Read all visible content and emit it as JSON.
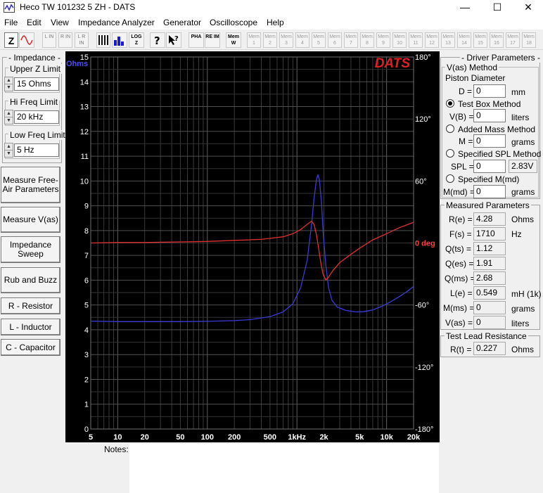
{
  "window": {
    "title": "Heco TW 101232 5 ZH - DATS",
    "minimize": "—",
    "maximize": "☐",
    "close": "✕"
  },
  "menu": [
    "File",
    "Edit",
    "View",
    "Impedance Analyzer",
    "Generator",
    "Oscilloscope",
    "Help"
  ],
  "toolbar": {
    "z_label": "Z",
    "lin": "L IN",
    "rin": "R IN",
    "lrin": "L R IN",
    "logz": "LOG Z",
    "pha": "PHA",
    "reim": "RE IM",
    "memw": "Mem W",
    "mem_label": "Mem",
    "mem_numbers": [
      "1",
      "2",
      "3",
      "4",
      "5",
      "6",
      "7",
      "8",
      "9",
      "10",
      "11",
      "12",
      "13",
      "14",
      "15",
      "16",
      "17",
      "18"
    ]
  },
  "left_panel": {
    "impedance_title": "- Impedance -",
    "upper_z": {
      "label": "Upper Z Limit",
      "value": "15 Ohms"
    },
    "hi_freq": {
      "label": "Hi Freq Limit",
      "value": "20 kHz"
    },
    "low_freq": {
      "label": "Low Freq Limit",
      "value": "5 Hz"
    },
    "buttons": [
      "Measure Free-Air Parameters",
      "Measure V(as)",
      "Impedance Sweep",
      "Rub and Buzz",
      "R - Resistor",
      "L - Inductor",
      "C - Capacitor"
    ]
  },
  "chart_data": {
    "type": "line",
    "title": "DATS",
    "x_scale": "log",
    "xlim": [
      5,
      20000
    ],
    "x_ticks": [
      {
        "value": 5,
        "label": "5"
      },
      {
        "value": 10,
        "label": "10"
      },
      {
        "value": 20,
        "label": "20"
      },
      {
        "value": 50,
        "label": "50"
      },
      {
        "value": 100,
        "label": "100"
      },
      {
        "value": 200,
        "label": "200"
      },
      {
        "value": 500,
        "label": "500"
      },
      {
        "value": 1000,
        "label": "1kHz"
      },
      {
        "value": 2000,
        "label": "2k"
      },
      {
        "value": 5000,
        "label": "5k"
      },
      {
        "value": 10000,
        "label": "10k"
      },
      {
        "value": 20000,
        "label": "20k"
      }
    ],
    "y_left": {
      "label": "Ohms",
      "min": 0,
      "max": 15,
      "ticks": [
        "0",
        "1",
        "2",
        "3",
        "4",
        "5",
        "6",
        "7",
        "8",
        "9",
        "10",
        "11",
        "12",
        "13",
        "14",
        "15"
      ]
    },
    "y_right": {
      "label": "deg",
      "min": -180,
      "max": 180,
      "ticks": [
        {
          "value": 180,
          "label": "180°"
        },
        {
          "value": 120,
          "label": "120°"
        },
        {
          "value": 60,
          "label": "60°"
        },
        {
          "value": 0,
          "label": "0 deg"
        },
        {
          "value": -60,
          "label": "-60°"
        },
        {
          "value": -120,
          "label": "-120°"
        },
        {
          "value": -180,
          "label": "-180°"
        }
      ]
    },
    "grid": true,
    "series": [
      {
        "axis": "left",
        "color": "#3a3ad8",
        "points": [
          [
            5,
            4.35
          ],
          [
            10,
            4.33
          ],
          [
            50,
            4.33
          ],
          [
            100,
            4.34
          ],
          [
            200,
            4.37
          ],
          [
            300,
            4.41
          ],
          [
            500,
            4.53
          ],
          [
            700,
            4.72
          ],
          [
            900,
            5.05
          ],
          [
            1100,
            5.7
          ],
          [
            1300,
            6.8
          ],
          [
            1450,
            8.2
          ],
          [
            1550,
            9.3
          ],
          [
            1650,
            10.05
          ],
          [
            1710,
            10.25
          ],
          [
            1780,
            10.05
          ],
          [
            1870,
            9.2
          ],
          [
            1970,
            7.8
          ],
          [
            2100,
            6.6
          ],
          [
            2250,
            5.7
          ],
          [
            2450,
            5.2
          ],
          [
            2800,
            4.92
          ],
          [
            3500,
            4.78
          ],
          [
            4500,
            4.72
          ],
          [
            5500,
            4.73
          ],
          [
            7000,
            4.8
          ],
          [
            9000,
            4.96
          ],
          [
            11000,
            5.12
          ],
          [
            14000,
            5.35
          ],
          [
            17000,
            5.55
          ],
          [
            20000,
            5.75
          ]
        ]
      },
      {
        "axis": "right",
        "color": "#e03030",
        "points": [
          [
            5,
            0
          ],
          [
            10,
            0.5
          ],
          [
            20,
            0.5
          ],
          [
            50,
            1
          ],
          [
            100,
            1.5
          ],
          [
            200,
            2.5
          ],
          [
            400,
            3.5
          ],
          [
            700,
            6
          ],
          [
            900,
            9
          ],
          [
            1100,
            13
          ],
          [
            1300,
            18
          ],
          [
            1450,
            21
          ],
          [
            1550,
            18
          ],
          [
            1650,
            8
          ],
          [
            1750,
            -6
          ],
          [
            1850,
            -20
          ],
          [
            1950,
            -30
          ],
          [
            2100,
            -36
          ],
          [
            2250,
            -33
          ],
          [
            2500,
            -27
          ],
          [
            3000,
            -19
          ],
          [
            4000,
            -11
          ],
          [
            5000,
            -5
          ],
          [
            7000,
            3
          ],
          [
            10000,
            9
          ],
          [
            14000,
            15
          ],
          [
            20000,
            20
          ]
        ]
      }
    ]
  },
  "driver_parameters": {
    "title": "- Driver Parameters -",
    "vas_method": "V(as) Method",
    "piston_diameter": "Piston Diameter",
    "d": {
      "label": "D =",
      "value": "0",
      "unit": "mm"
    },
    "test_box": {
      "label": "Test Box Method",
      "selected": true
    },
    "vb": {
      "label": "V(B) =",
      "value": "0",
      "unit": "liters"
    },
    "added_mass": {
      "label": "Added Mass Method"
    },
    "m": {
      "label": "M =",
      "value": "0",
      "unit": "grams"
    },
    "spl": {
      "label": "Specified SPL Method"
    },
    "spl_field": {
      "label": "SPL =",
      "value": "0",
      "unit": "2.83V"
    },
    "mmd_spec": {
      "label": "Specified M(md)"
    },
    "mmd": {
      "label": "M(md) =",
      "value": "0",
      "unit": "grams"
    }
  },
  "measured": {
    "title": "Measured Parameters",
    "rows": [
      {
        "label": "R(e) =",
        "value": "4.28",
        "unit": "Ohms"
      },
      {
        "label": "F(s) =",
        "value": "1710",
        "unit": "Hz"
      },
      {
        "label": "Q(ts) =",
        "value": "1.12",
        "unit": ""
      },
      {
        "label": "Q(es) =",
        "value": "1.91",
        "unit": ""
      },
      {
        "label": "Q(ms) =",
        "value": "2.68",
        "unit": ""
      },
      {
        "label": "L(e) =",
        "value": "0.549",
        "unit": "mH (1k)"
      },
      {
        "label": "M(ms) =",
        "value": "0",
        "unit": "grams"
      },
      {
        "label": "V(as) =",
        "value": "0",
        "unit": "liters"
      }
    ]
  },
  "lead": {
    "title": "Test Lead Resistance",
    "label": "R(t) =",
    "value": "0.227",
    "unit": "Ohms"
  },
  "notes": {
    "label": "Notes:"
  }
}
